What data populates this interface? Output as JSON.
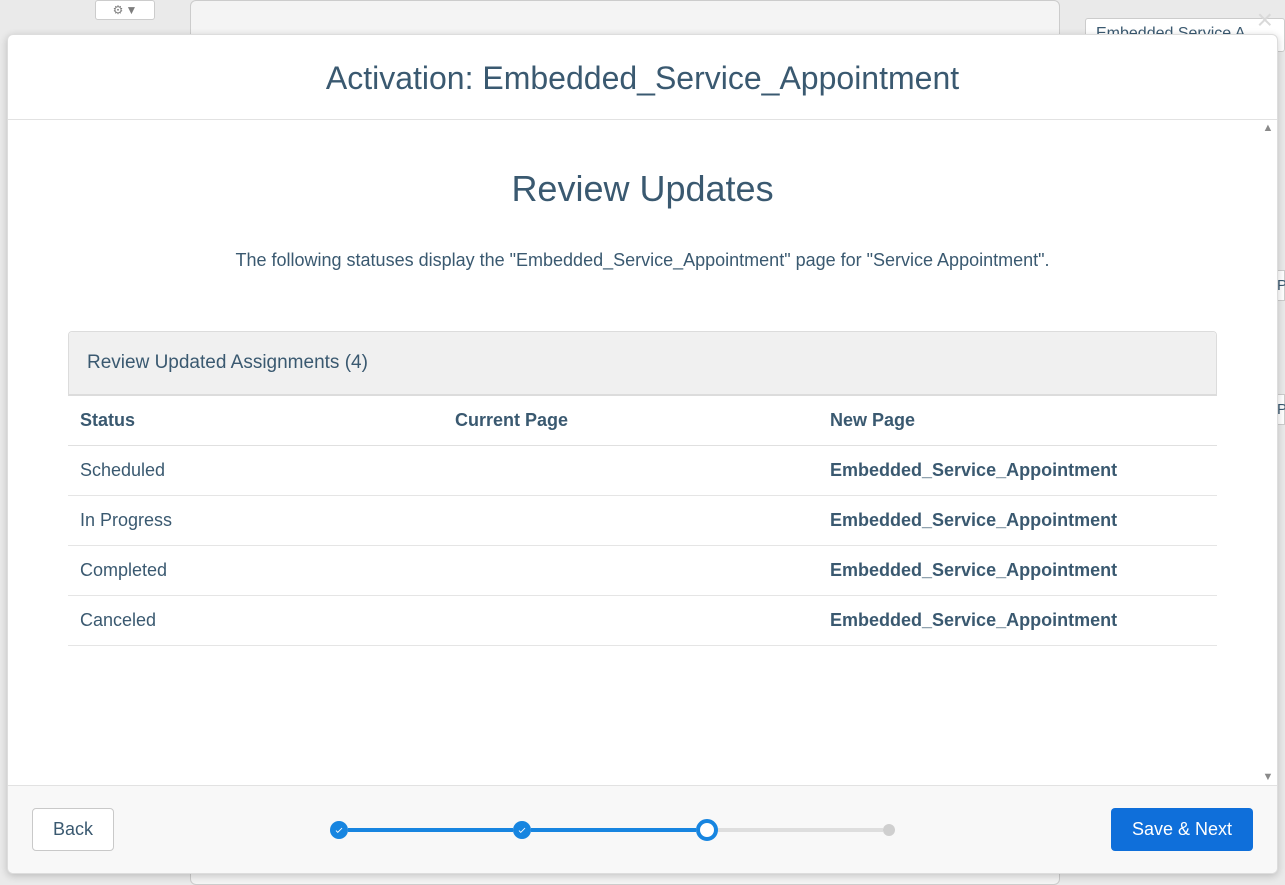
{
  "background": {
    "right_label": "Embedded Service A",
    "p1": "P",
    "p2": "P"
  },
  "modal": {
    "close_label": "×",
    "title": "Activation: Embedded_Service_Appointment",
    "section_title": "Review Updates",
    "subtitle": "The following statuses display the \"Embedded_Service_Appointment\" page for \"Service Appointment\".",
    "panel_title": "Review Updated Assignments (4)",
    "columns": {
      "status": "Status",
      "current": "Current Page",
      "newpage": "New Page"
    },
    "rows": [
      {
        "status": "Scheduled",
        "current": "",
        "newpage": "Embedded_Service_Appointment"
      },
      {
        "status": "In Progress",
        "current": "",
        "newpage": "Embedded_Service_Appointment"
      },
      {
        "status": "Completed",
        "current": "",
        "newpage": "Embedded_Service_Appointment"
      },
      {
        "status": "Canceled",
        "current": "",
        "newpage": "Embedded_Service_Appointment"
      }
    ],
    "footer": {
      "back": "Back",
      "save_next": "Save & Next"
    },
    "progress": {
      "total_steps": 4,
      "current_step": 3
    }
  }
}
